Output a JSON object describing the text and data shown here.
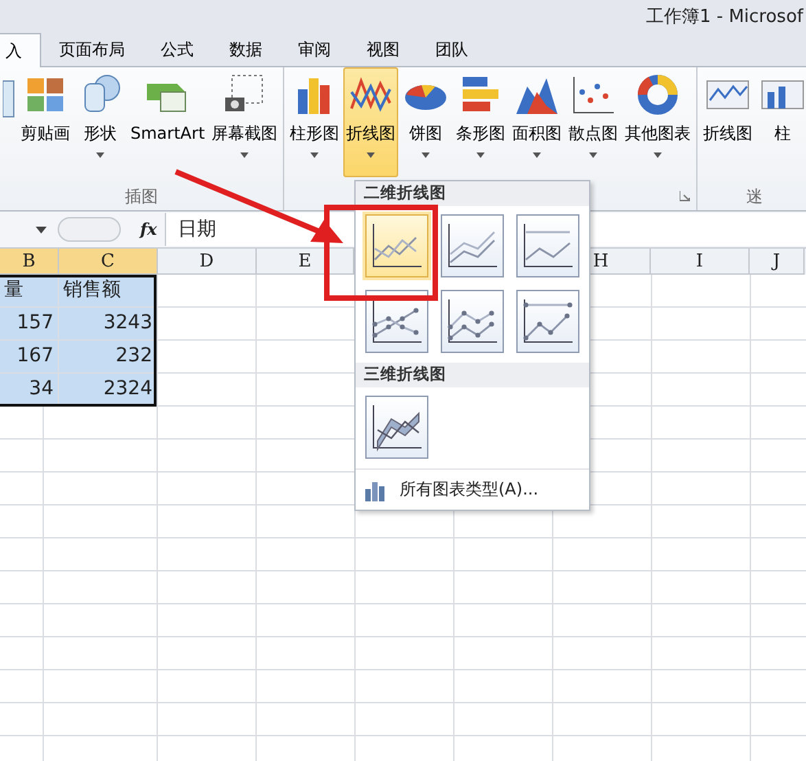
{
  "window": {
    "title": "工作簿1 - Microsof"
  },
  "tabs": [
    {
      "label": "入",
      "selected": true
    },
    {
      "label": "页面布局",
      "selected": false
    },
    {
      "label": "公式",
      "selected": false
    },
    {
      "label": "数据",
      "selected": false
    },
    {
      "label": "审阅",
      "selected": false
    },
    {
      "label": "视图",
      "selected": false
    },
    {
      "label": "团队",
      "selected": false
    }
  ],
  "ribbon": {
    "groups": [
      {
        "label": "插图",
        "buttons": [
          {
            "label": "剪贴画",
            "menu": false,
            "selected": false
          },
          {
            "label": "形状",
            "menu": true,
            "selected": false
          },
          {
            "label": "SmartArt",
            "menu": false,
            "selected": false
          },
          {
            "label": "屏幕截图",
            "menu": true,
            "selected": false
          }
        ]
      },
      {
        "buttons": [
          {
            "label": "柱形图",
            "menu": true,
            "selected": false
          },
          {
            "label": "折线图",
            "menu": true,
            "selected": true
          },
          {
            "label": "饼图",
            "menu": true,
            "selected": false
          },
          {
            "label": "条形图",
            "menu": true,
            "selected": false
          },
          {
            "label": "面积图",
            "menu": true,
            "selected": false
          },
          {
            "label": "散点图",
            "menu": true,
            "selected": false
          },
          {
            "label": "其他图表",
            "menu": true,
            "selected": false
          }
        ]
      },
      {
        "label": "迷",
        "buttons": [
          {
            "label": "折线图",
            "menu": false,
            "selected": false
          },
          {
            "label": "柱",
            "menu": false,
            "selected": false
          }
        ]
      }
    ]
  },
  "formula_bar": {
    "fx": "fx",
    "value": "日期"
  },
  "sheet": {
    "columns": [
      "B",
      "C",
      "D",
      "E",
      "H",
      "I",
      "J"
    ],
    "rows": [
      {
        "cells": [
          "量",
          "销售额"
        ],
        "kind": "header"
      },
      {
        "cells": [
          "157",
          "3243"
        ],
        "kind": "number"
      },
      {
        "cells": [
          "167",
          "232"
        ],
        "kind": "number"
      },
      {
        "cells": [
          "34",
          "2324"
        ],
        "kind": "number"
      }
    ]
  },
  "dropdown": {
    "sections": [
      {
        "title": "二维折线图",
        "items": [
          {
            "kind": "line",
            "selected": true
          },
          {
            "kind": "stacked",
            "selected": false
          },
          {
            "kind": "percent",
            "selected": false
          },
          {
            "kind": "markers",
            "selected": false
          },
          {
            "kind": "stacked-markers",
            "selected": false
          },
          {
            "kind": "percent-markers",
            "selected": false
          }
        ]
      },
      {
        "title": "三维折线图",
        "items": [
          {
            "kind": "perspective",
            "selected": false
          }
        ]
      }
    ],
    "footer": "所有图表类型(A)..."
  }
}
